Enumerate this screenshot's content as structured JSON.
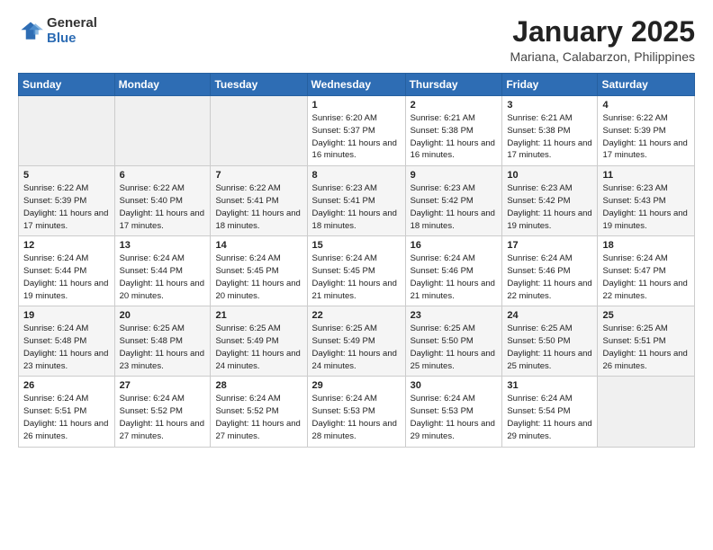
{
  "logo": {
    "general": "General",
    "blue": "Blue"
  },
  "header": {
    "title": "January 2025",
    "subtitle": "Mariana, Calabarzon, Philippines"
  },
  "weekdays": [
    "Sunday",
    "Monday",
    "Tuesday",
    "Wednesday",
    "Thursday",
    "Friday",
    "Saturday"
  ],
  "weeks": [
    [
      {
        "day": "",
        "sunrise": "",
        "sunset": "",
        "daylight": ""
      },
      {
        "day": "",
        "sunrise": "",
        "sunset": "",
        "daylight": ""
      },
      {
        "day": "",
        "sunrise": "",
        "sunset": "",
        "daylight": ""
      },
      {
        "day": "1",
        "sunrise": "Sunrise: 6:20 AM",
        "sunset": "Sunset: 5:37 PM",
        "daylight": "Daylight: 11 hours and 16 minutes."
      },
      {
        "day": "2",
        "sunrise": "Sunrise: 6:21 AM",
        "sunset": "Sunset: 5:38 PM",
        "daylight": "Daylight: 11 hours and 16 minutes."
      },
      {
        "day": "3",
        "sunrise": "Sunrise: 6:21 AM",
        "sunset": "Sunset: 5:38 PM",
        "daylight": "Daylight: 11 hours and 17 minutes."
      },
      {
        "day": "4",
        "sunrise": "Sunrise: 6:22 AM",
        "sunset": "Sunset: 5:39 PM",
        "daylight": "Daylight: 11 hours and 17 minutes."
      }
    ],
    [
      {
        "day": "5",
        "sunrise": "Sunrise: 6:22 AM",
        "sunset": "Sunset: 5:39 PM",
        "daylight": "Daylight: 11 hours and 17 minutes."
      },
      {
        "day": "6",
        "sunrise": "Sunrise: 6:22 AM",
        "sunset": "Sunset: 5:40 PM",
        "daylight": "Daylight: 11 hours and 17 minutes."
      },
      {
        "day": "7",
        "sunrise": "Sunrise: 6:22 AM",
        "sunset": "Sunset: 5:41 PM",
        "daylight": "Daylight: 11 hours and 18 minutes."
      },
      {
        "day": "8",
        "sunrise": "Sunrise: 6:23 AM",
        "sunset": "Sunset: 5:41 PM",
        "daylight": "Daylight: 11 hours and 18 minutes."
      },
      {
        "day": "9",
        "sunrise": "Sunrise: 6:23 AM",
        "sunset": "Sunset: 5:42 PM",
        "daylight": "Daylight: 11 hours and 18 minutes."
      },
      {
        "day": "10",
        "sunrise": "Sunrise: 6:23 AM",
        "sunset": "Sunset: 5:42 PM",
        "daylight": "Daylight: 11 hours and 19 minutes."
      },
      {
        "day": "11",
        "sunrise": "Sunrise: 6:23 AM",
        "sunset": "Sunset: 5:43 PM",
        "daylight": "Daylight: 11 hours and 19 minutes."
      }
    ],
    [
      {
        "day": "12",
        "sunrise": "Sunrise: 6:24 AM",
        "sunset": "Sunset: 5:44 PM",
        "daylight": "Daylight: 11 hours and 19 minutes."
      },
      {
        "day": "13",
        "sunrise": "Sunrise: 6:24 AM",
        "sunset": "Sunset: 5:44 PM",
        "daylight": "Daylight: 11 hours and 20 minutes."
      },
      {
        "day": "14",
        "sunrise": "Sunrise: 6:24 AM",
        "sunset": "Sunset: 5:45 PM",
        "daylight": "Daylight: 11 hours and 20 minutes."
      },
      {
        "day": "15",
        "sunrise": "Sunrise: 6:24 AM",
        "sunset": "Sunset: 5:45 PM",
        "daylight": "Daylight: 11 hours and 21 minutes."
      },
      {
        "day": "16",
        "sunrise": "Sunrise: 6:24 AM",
        "sunset": "Sunset: 5:46 PM",
        "daylight": "Daylight: 11 hours and 21 minutes."
      },
      {
        "day": "17",
        "sunrise": "Sunrise: 6:24 AM",
        "sunset": "Sunset: 5:46 PM",
        "daylight": "Daylight: 11 hours and 22 minutes."
      },
      {
        "day": "18",
        "sunrise": "Sunrise: 6:24 AM",
        "sunset": "Sunset: 5:47 PM",
        "daylight": "Daylight: 11 hours and 22 minutes."
      }
    ],
    [
      {
        "day": "19",
        "sunrise": "Sunrise: 6:24 AM",
        "sunset": "Sunset: 5:48 PM",
        "daylight": "Daylight: 11 hours and 23 minutes."
      },
      {
        "day": "20",
        "sunrise": "Sunrise: 6:25 AM",
        "sunset": "Sunset: 5:48 PM",
        "daylight": "Daylight: 11 hours and 23 minutes."
      },
      {
        "day": "21",
        "sunrise": "Sunrise: 6:25 AM",
        "sunset": "Sunset: 5:49 PM",
        "daylight": "Daylight: 11 hours and 24 minutes."
      },
      {
        "day": "22",
        "sunrise": "Sunrise: 6:25 AM",
        "sunset": "Sunset: 5:49 PM",
        "daylight": "Daylight: 11 hours and 24 minutes."
      },
      {
        "day": "23",
        "sunrise": "Sunrise: 6:25 AM",
        "sunset": "Sunset: 5:50 PM",
        "daylight": "Daylight: 11 hours and 25 minutes."
      },
      {
        "day": "24",
        "sunrise": "Sunrise: 6:25 AM",
        "sunset": "Sunset: 5:50 PM",
        "daylight": "Daylight: 11 hours and 25 minutes."
      },
      {
        "day": "25",
        "sunrise": "Sunrise: 6:25 AM",
        "sunset": "Sunset: 5:51 PM",
        "daylight": "Daylight: 11 hours and 26 minutes."
      }
    ],
    [
      {
        "day": "26",
        "sunrise": "Sunrise: 6:24 AM",
        "sunset": "Sunset: 5:51 PM",
        "daylight": "Daylight: 11 hours and 26 minutes."
      },
      {
        "day": "27",
        "sunrise": "Sunrise: 6:24 AM",
        "sunset": "Sunset: 5:52 PM",
        "daylight": "Daylight: 11 hours and 27 minutes."
      },
      {
        "day": "28",
        "sunrise": "Sunrise: 6:24 AM",
        "sunset": "Sunset: 5:52 PM",
        "daylight": "Daylight: 11 hours and 27 minutes."
      },
      {
        "day": "29",
        "sunrise": "Sunrise: 6:24 AM",
        "sunset": "Sunset: 5:53 PM",
        "daylight": "Daylight: 11 hours and 28 minutes."
      },
      {
        "day": "30",
        "sunrise": "Sunrise: 6:24 AM",
        "sunset": "Sunset: 5:53 PM",
        "daylight": "Daylight: 11 hours and 29 minutes."
      },
      {
        "day": "31",
        "sunrise": "Sunrise: 6:24 AM",
        "sunset": "Sunset: 5:54 PM",
        "daylight": "Daylight: 11 hours and 29 minutes."
      },
      {
        "day": "",
        "sunrise": "",
        "sunset": "",
        "daylight": ""
      }
    ]
  ]
}
